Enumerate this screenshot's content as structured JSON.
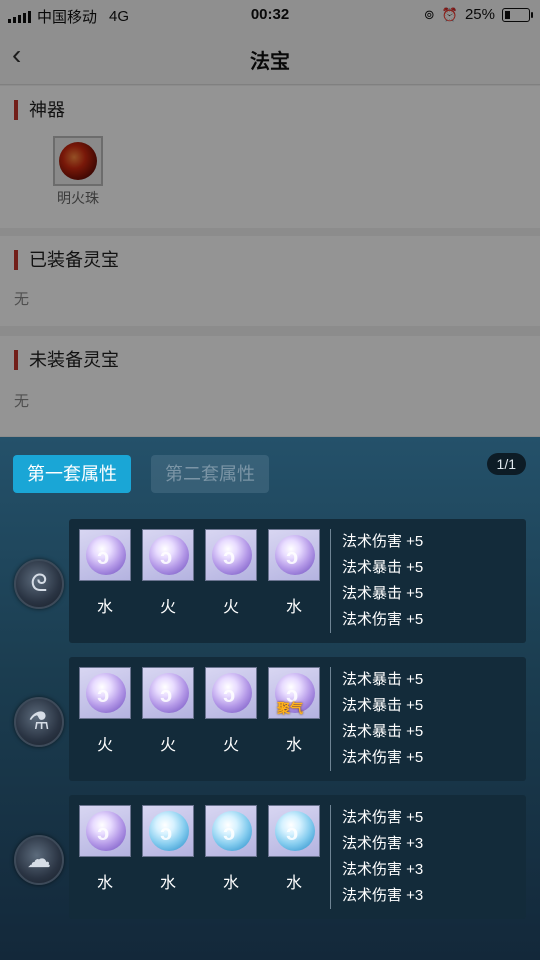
{
  "status_bar": {
    "carrier": "中国移动",
    "network": "4G",
    "time": "00:32",
    "battery": "25%"
  },
  "nav": {
    "back_icon": "‹",
    "title": "法宝"
  },
  "sections": {
    "artifact": {
      "title": "神器",
      "items": [
        {
          "label": "明火珠"
        }
      ]
    },
    "equipped": {
      "title": "已装备灵宝",
      "empty": "无"
    },
    "unequipped": {
      "title": "未装备灵宝",
      "empty": "无"
    }
  },
  "sheet": {
    "tabs": [
      {
        "label": "第一套属性",
        "active": true
      },
      {
        "label": "第二套属性",
        "active": false
      }
    ],
    "pager": "1/1",
    "rows": [
      {
        "icon": "spiral-icon",
        "gems": [
          {
            "label": "水",
            "style": "purple"
          },
          {
            "label": "火",
            "style": "purple"
          },
          {
            "label": "火",
            "style": "purple"
          },
          {
            "label": "水",
            "style": "purple"
          }
        ],
        "attrs": [
          "法术伤害 +5",
          "法术暴击 +5",
          "法术暴击 +5",
          "法术伤害 +5"
        ]
      },
      {
        "icon": "flask-icon",
        "gems": [
          {
            "label": "火",
            "style": "purple"
          },
          {
            "label": "火",
            "style": "purple"
          },
          {
            "label": "火",
            "style": "purple"
          },
          {
            "label": "水",
            "style": "purple",
            "tag": "聚气"
          }
        ],
        "attrs": [
          "法术暴击 +5",
          "法术暴击 +5",
          "法术暴击 +5",
          "法术伤害 +5"
        ]
      },
      {
        "icon": "cloud-icon",
        "gems": [
          {
            "label": "水",
            "style": "purple"
          },
          {
            "label": "水",
            "style": "blue"
          },
          {
            "label": "水",
            "style": "blue"
          },
          {
            "label": "水",
            "style": "blue"
          }
        ],
        "attrs": [
          "法术伤害 +5",
          "法术伤害 +3",
          "法术伤害 +3",
          "法术伤害 +3"
        ]
      }
    ]
  },
  "colors": {
    "accent": "#1aa6d6",
    "section_marker": "#c4362b",
    "sheet_top": "#24516a",
    "sheet_bottom": "#13283a"
  }
}
